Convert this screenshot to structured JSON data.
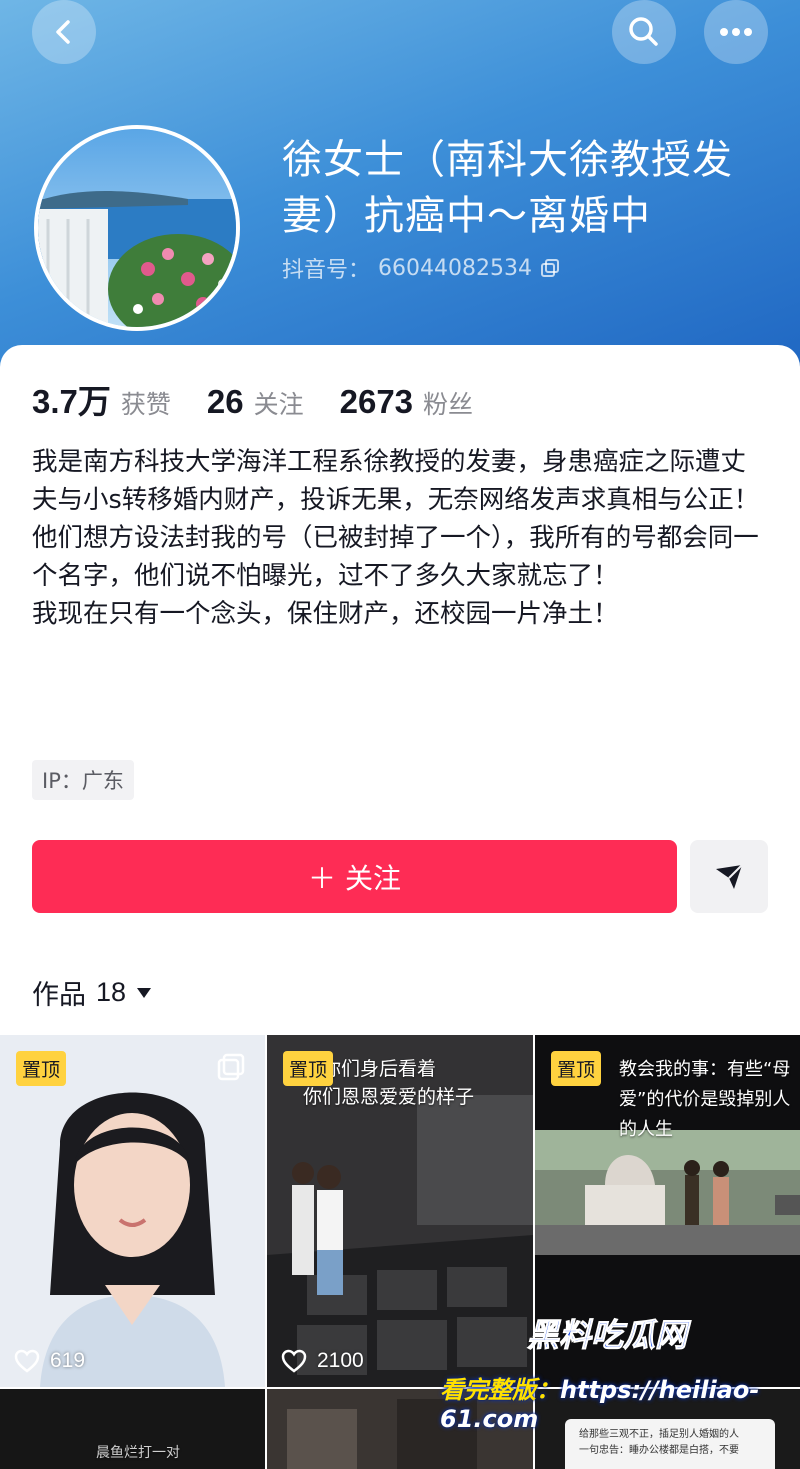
{
  "profile": {
    "name": "徐女士（南科大徐教授发妻）抗癌中～离婚中",
    "douyin_id_label": "抖音号：",
    "douyin_id": "66044082534"
  },
  "stats": [
    {
      "value": "3.7万",
      "label": "获赞"
    },
    {
      "value": "26",
      "label": "关注"
    },
    {
      "value": "2673",
      "label": "粉丝"
    }
  ],
  "bio": "我是南方科技大学海洋工程系徐教授的发妻，身患癌症之际遭丈夫与小s转移婚内财产，投诉无果，无奈网络发声求真相与公正！\n他们想方设法封我的号（已被封掉了一个），我所有的号都会同一个名字，他们说不怕曝光，过不了多久大家就忘了！\n我现在只有一个念头，保住财产，还校园一片净土！",
  "ip": "IP：广东",
  "actions": {
    "follow_label": "＋ 关注"
  },
  "works": {
    "label": "作品",
    "count": "18",
    "items": [
      {
        "pinned": "置顶",
        "likes": "619",
        "caption": ""
      },
      {
        "pinned": "置顶",
        "likes": "2100",
        "caption": "在你们身后看着\n你们恩恩爱爱的样子"
      },
      {
        "pinned": "置顶",
        "likes": "",
        "caption": "教会我的事：有些“母\n爱”的代价是毁掉别人的人生"
      },
      {
        "pinned": "",
        "likes": "",
        "caption": "晨鱼烂打一对"
      },
      {
        "pinned": "",
        "likes": "",
        "caption": ""
      },
      {
        "pinned": "",
        "likes": "",
        "caption": "给那些三观不正，插足别人婚姻的人\n一句忠告：睡办公楼都是白搭，不要"
      }
    ]
  },
  "watermark": {
    "brand": "黑料吃瓜网",
    "prefix": "看完整版：",
    "url": "https://heiliao-61.com"
  },
  "colors": {
    "accent": "#fe2c55",
    "pin": "#ffd23f",
    "header_gradient": [
      "#6fb6e6",
      "#1f66c2"
    ]
  },
  "icons": [
    "back-icon",
    "search-icon",
    "more-icon",
    "copy-icon",
    "share-icon",
    "caret-down-icon",
    "heart-icon",
    "multi-icon"
  ]
}
